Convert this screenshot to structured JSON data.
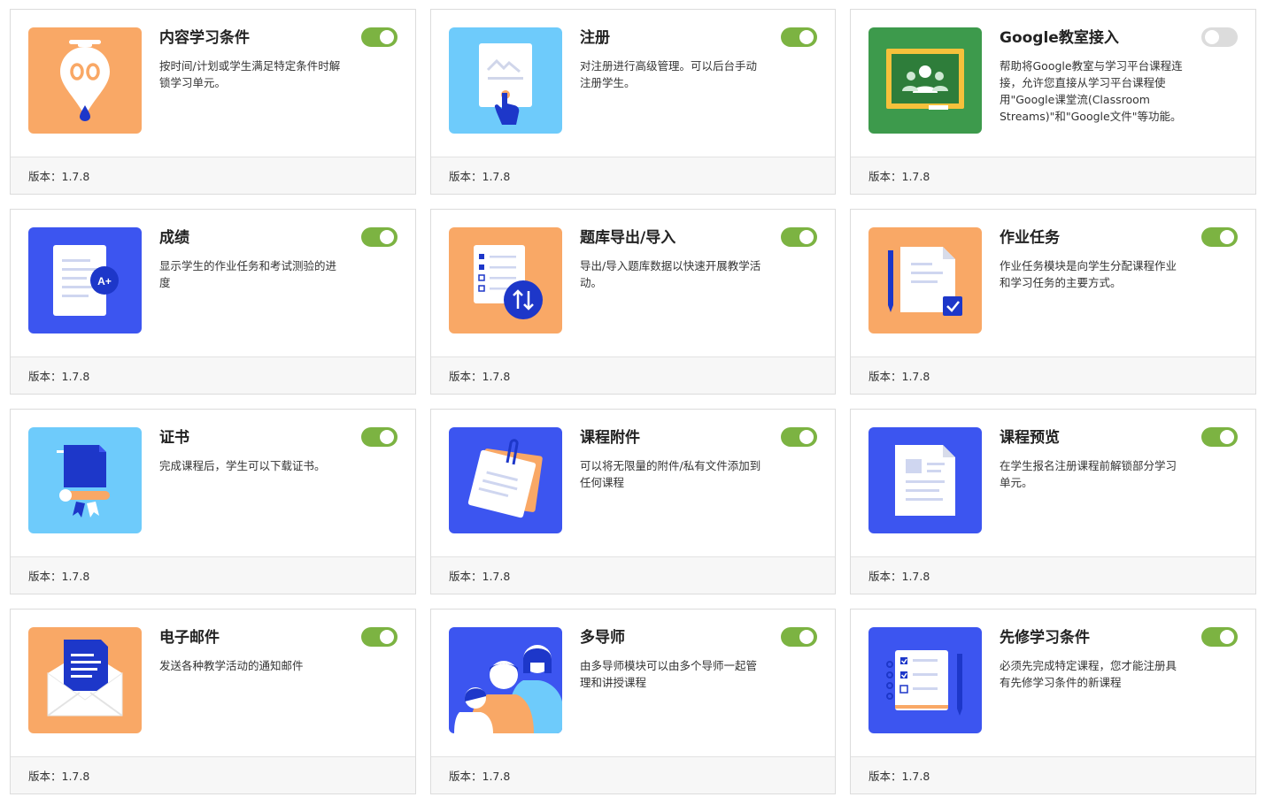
{
  "colors": {
    "toggle_on": "#7cb342",
    "toggle_off": "#dcdcdc",
    "orange": "#f9a866",
    "sky": "#6ecbfb",
    "blue": "#3c55f0",
    "navy": "#1d37c9",
    "green": "#3d9a4c"
  },
  "version_label": "版本：1.7.8",
  "addons": [
    {
      "title": "内容学习条件",
      "desc": "按时间/计划或学生满足特定条件时解锁学习单元。",
      "enabled": true,
      "icon": "drip-content-icon"
    },
    {
      "title": "注册",
      "desc": "对注册进行高级管理。可以后台手动注册学生。",
      "enabled": true,
      "icon": "enrollment-icon"
    },
    {
      "title": "Google教室接入",
      "desc": "帮助将Google教室与学习平台课程连接，允许您直接从学习平台课程使用\"Google课堂流(Classroom Streams)\"和\"Google文件\"等功能。",
      "enabled": false,
      "icon": "google-classroom-icon"
    },
    {
      "title": "成绩",
      "desc": "显示学生的作业任务和考试测验的进度",
      "enabled": true,
      "icon": "gradebook-icon"
    },
    {
      "title": "题库导出/导入",
      "desc": "导出/导入题库数据以快速开展教学活动。",
      "enabled": true,
      "icon": "quiz-export-import-icon"
    },
    {
      "title": "作业任务",
      "desc": "作业任务模块是向学生分配课程作业和学习任务的主要方式。",
      "enabled": true,
      "icon": "assignments-icon"
    },
    {
      "title": "证书",
      "desc": "完成课程后，学生可以下载证书。",
      "enabled": true,
      "icon": "certificate-icon"
    },
    {
      "title": "课程附件",
      "desc": "可以将无限量的附件/私有文件添加到任何课程",
      "enabled": true,
      "icon": "course-attachments-icon"
    },
    {
      "title": "课程预览",
      "desc": "在学生报名注册课程前解锁部分学习单元。",
      "enabled": true,
      "icon": "course-preview-icon"
    },
    {
      "title": "电子邮件",
      "desc": "发送各种教学活动的通知邮件",
      "enabled": true,
      "icon": "email-icon"
    },
    {
      "title": "多导师",
      "desc": "由多导师模块可以由多个导师一起管理和讲授课程",
      "enabled": true,
      "icon": "multi-instructor-icon"
    },
    {
      "title": "先修学习条件",
      "desc": "必须先完成特定课程，您才能注册具有先修学习条件的新课程",
      "enabled": true,
      "icon": "prerequisites-icon"
    }
  ]
}
